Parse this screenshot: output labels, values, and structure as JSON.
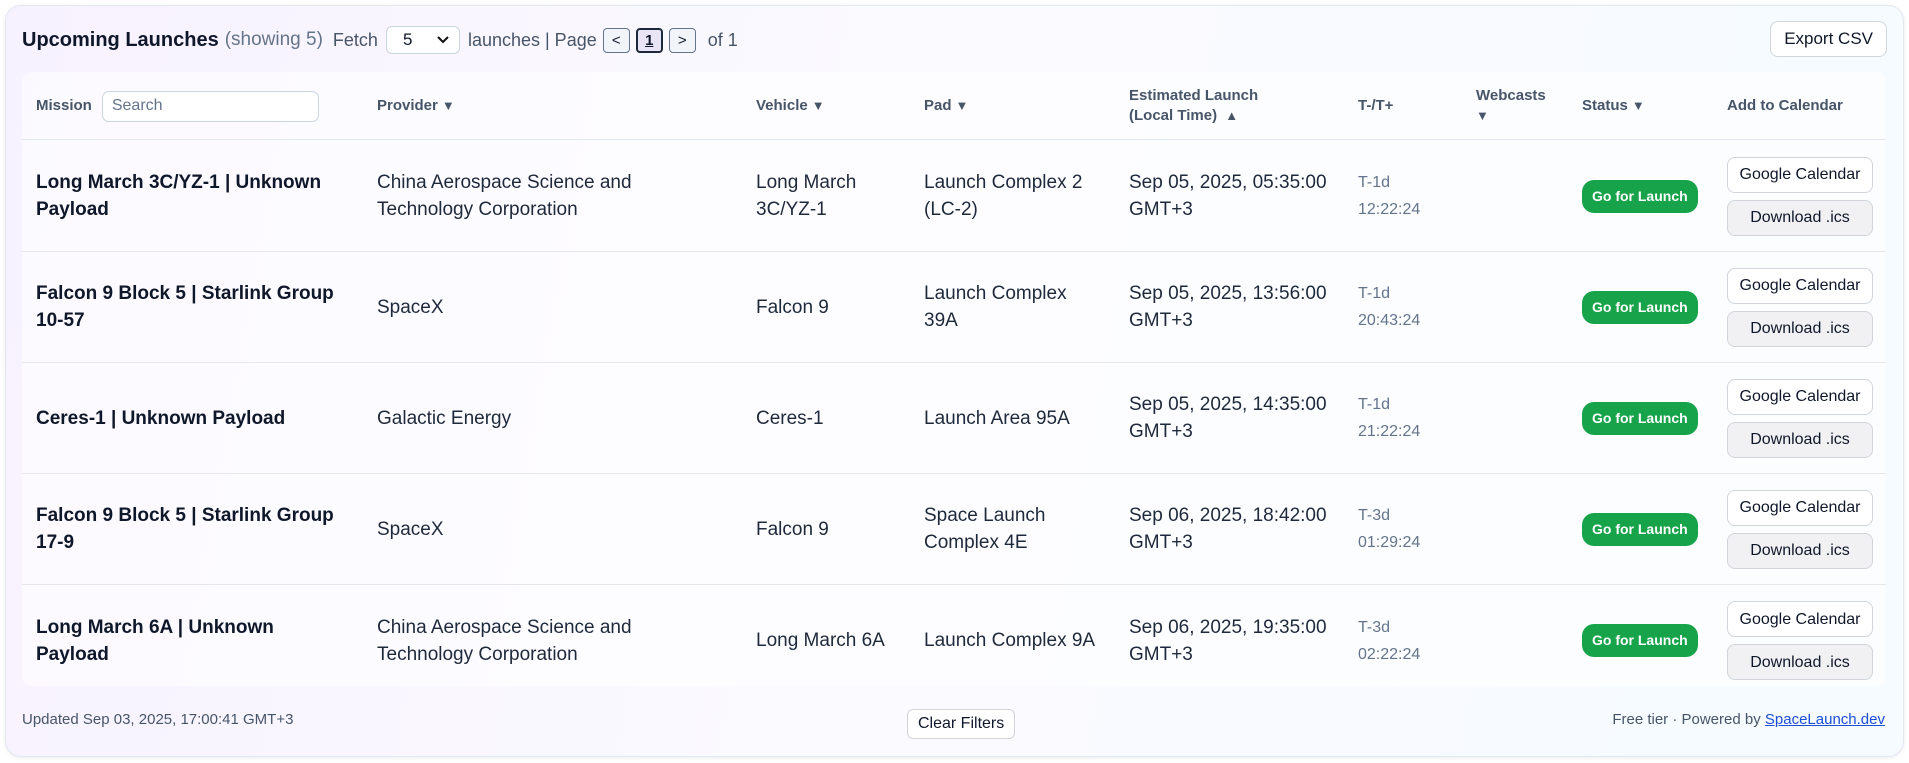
{
  "header": {
    "title": "Upcoming Launches",
    "showing": "(showing 5)",
    "fetch_label": "Fetch",
    "fetch_value": "5",
    "launches_page_label": "launches | Page",
    "prev_label": "<",
    "current_page": "1",
    "next_label": ">",
    "of_label": "of 1",
    "export_label": "Export CSV"
  },
  "columns": {
    "mission": "Mission",
    "search_placeholder": "Search",
    "provider": "Provider",
    "vehicle": "Vehicle",
    "pad": "Pad",
    "estimated_launch": "Estimated Launch (Local Time)",
    "tminus": "T-/T+",
    "webcasts": "Webcasts",
    "status": "Status",
    "add_to_calendar": "Add to Calendar"
  },
  "rows": [
    {
      "mission": "Long March 3C/YZ-1 | Unknown Payload",
      "provider": "China Aerospace Science and Technology Corporation",
      "vehicle": "Long March 3C/YZ-1",
      "pad": "Launch Complex 2 (LC-2)",
      "launch_time": "Sep 05, 2025, 05:35:00 GMT+3",
      "t_days": "T-1d",
      "t_time": "12:22:24",
      "webcasts": "",
      "status": "Go for Launch",
      "google_label": "Google Calendar",
      "ics_label": "Download .ics"
    },
    {
      "mission": "Falcon 9 Block 5 | Starlink Group 10-57",
      "provider": "SpaceX",
      "vehicle": "Falcon 9",
      "pad": "Launch Complex 39A",
      "launch_time": "Sep 05, 2025, 13:56:00 GMT+3",
      "t_days": "T-1d",
      "t_time": "20:43:24",
      "webcasts": "",
      "status": "Go for Launch",
      "google_label": "Google Calendar",
      "ics_label": "Download .ics"
    },
    {
      "mission": "Ceres-1 | Unknown Payload",
      "provider": "Galactic Energy",
      "vehicle": "Ceres-1",
      "pad": "Launch Area 95A",
      "launch_time": "Sep 05, 2025, 14:35:00 GMT+3",
      "t_days": "T-1d",
      "t_time": "21:22:24",
      "webcasts": "",
      "status": "Go for Launch",
      "google_label": "Google Calendar",
      "ics_label": "Download .ics"
    },
    {
      "mission": "Falcon 9 Block 5 | Starlink Group 17-9",
      "provider": "SpaceX",
      "vehicle": "Falcon 9",
      "pad": "Space Launch Complex 4E",
      "launch_time": "Sep 06, 2025, 18:42:00 GMT+3",
      "t_days": "T-3d",
      "t_time": "01:29:24",
      "webcasts": "",
      "status": "Go for Launch",
      "google_label": "Google Calendar",
      "ics_label": "Download .ics"
    },
    {
      "mission": "Long March 6A | Unknown Payload",
      "provider": "China Aerospace Science and Technology Corporation",
      "vehicle": "Long March 6A",
      "pad": "Launch Complex 9A",
      "launch_time": "Sep 06, 2025, 19:35:00 GMT+3",
      "t_days": "T-3d",
      "t_time": "02:22:24",
      "webcasts": "",
      "status": "Go for Launch",
      "google_label": "Google Calendar",
      "ics_label": "Download .ics"
    }
  ],
  "footer": {
    "updated": "Updated Sep 03, 2025, 17:00:41 GMT+3",
    "clear_filters": "Clear Filters",
    "powered_prefix": "Free tier · Powered by",
    "powered_link": "SpaceLaunch.dev"
  },
  "colors": {
    "status_go": "#16a34a",
    "link": "#1d4ed8"
  },
  "icons": {
    "sort_desc": "triangle-down-icon",
    "sort_asc": "triangle-up-icon",
    "select": "chevron-down-icon"
  }
}
